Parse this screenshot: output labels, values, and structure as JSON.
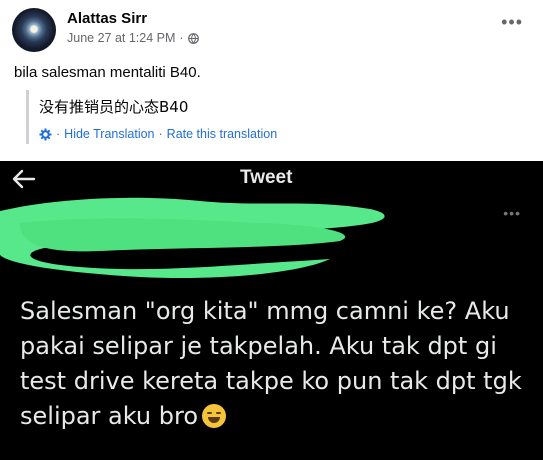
{
  "post": {
    "author": "Alattas Sirr",
    "timestamp": "June 27 at 1:24 PM",
    "separator": "·",
    "privacy_icon": "globe-icon",
    "more_icon": "more-options-icon",
    "text": "bila salesman mentaliti B40.",
    "translation": {
      "text": "没有推销员的心态B40",
      "settings_icon": "gear-icon",
      "hide_label": "Hide Translation",
      "rate_label": "Rate this translation",
      "dot": "·"
    }
  },
  "tweet": {
    "back_icon": "back-arrow-icon",
    "title": "Tweet",
    "more_icon": "more-options-icon",
    "redaction_color": "#56e88a",
    "body": "Salesman \"org kita\" mmg camni ke? Aku pakai selipar je takpelah. Aku tak dpt gi test drive kereta takpe ko pun tak dpt tgk selipar aku bro",
    "emoji": "face-with-tears-of-joy-emoji"
  },
  "colors": {
    "link": "#216fdb",
    "tweet_bg": "#000000",
    "tweet_text": "#e7e9ea",
    "meta_text": "#65676b"
  }
}
